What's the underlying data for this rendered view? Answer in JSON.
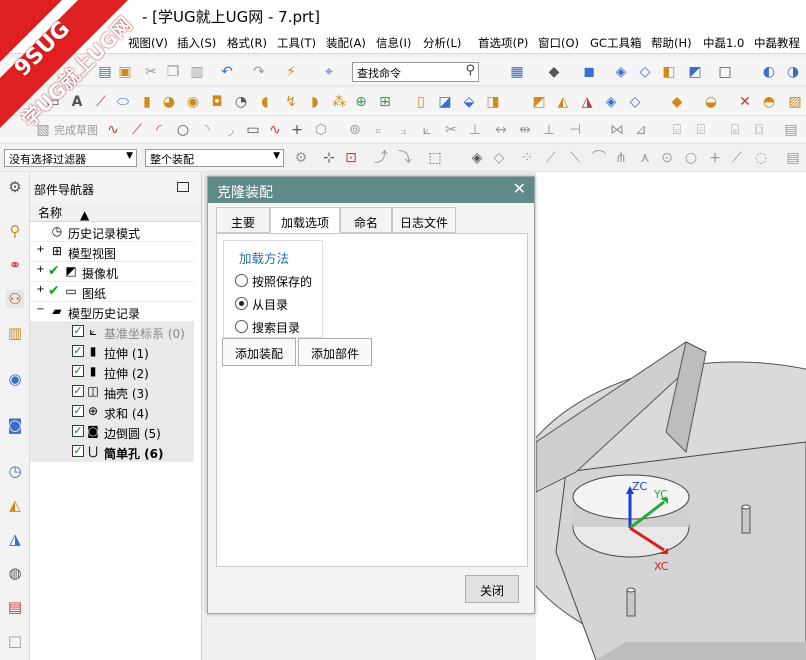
{
  "window": {
    "title": "- [学UG就上UG网 - 7.prt]"
  },
  "brand": {
    "text1": "9SUG",
    "text2": "学UG就上UG网"
  },
  "menu": {
    "items": [
      "视图(V)",
      "插入(S)",
      "格式(R)",
      "工具(T)",
      "装配(A)",
      "信息(I)",
      "分析(L)",
      "首选项(P)",
      "窗口(O)",
      "GC工具箱",
      "帮助(H)",
      "中磊1.0",
      "中磊教程"
    ]
  },
  "toolbar": {
    "search_placeholder": "查找命令",
    "sketch_finish": "完成草图"
  },
  "selection": {
    "filter": "没有选择过滤器",
    "scope": "整个装配"
  },
  "navigator": {
    "title": "部件导航器",
    "column_name": "名称",
    "nodes": [
      {
        "label": "历史记录模式"
      },
      {
        "label": "模型视图"
      },
      {
        "label": "摄像机"
      },
      {
        "label": "图纸"
      },
      {
        "label": "模型历史记录"
      },
      {
        "label": "基准坐标系 (0)"
      },
      {
        "label": "拉伸 (1)"
      },
      {
        "label": "拉伸 (2)"
      },
      {
        "label": "抽壳 (3)"
      },
      {
        "label": "求和 (4)"
      },
      {
        "label": "边倒圆 (5)"
      },
      {
        "label": "简单孔 (6)"
      }
    ]
  },
  "dialog": {
    "title": "克隆装配",
    "tabs": [
      "主要",
      "加载选项",
      "命名",
      "日志文件"
    ],
    "active_tab": "加载选项",
    "group_title": "加载方法",
    "options": [
      {
        "label": "按照保存的",
        "selected": false
      },
      {
        "label": "从目录",
        "selected": true
      },
      {
        "label": "搜索目录",
        "selected": false
      }
    ],
    "add_assembly": "添加装配",
    "add_part": "添加部件",
    "close": "关闭"
  },
  "viewport": {
    "axis_z": "ZC",
    "axis_y": "YC",
    "axis_x": "XC"
  },
  "colors": {
    "dialog_title": "#5f8a88",
    "group_title": "#2b6db1",
    "axis_z": "#1d3fd1",
    "axis_y": "#2aa83a",
    "axis_x": "#d62020"
  }
}
